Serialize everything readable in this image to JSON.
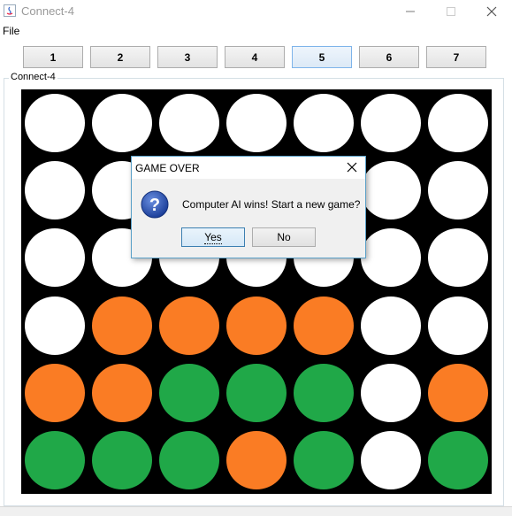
{
  "window": {
    "title": "Connect-4"
  },
  "menu": {
    "file": "File"
  },
  "column_buttons": [
    "1",
    "2",
    "3",
    "4",
    "5",
    "6",
    "7"
  ],
  "active_column_index": 4,
  "group": {
    "label": "Connect-4"
  },
  "board": {
    "rows": 6,
    "cols": 7,
    "cells": [
      [
        "empty",
        "empty",
        "empty",
        "empty",
        "empty",
        "empty",
        "empty"
      ],
      [
        "empty",
        "empty",
        "empty",
        "empty",
        "empty",
        "empty",
        "empty"
      ],
      [
        "empty",
        "empty",
        "empty",
        "empty",
        "empty",
        "empty",
        "empty"
      ],
      [
        "empty",
        "orange",
        "orange",
        "orange",
        "orange",
        "empty",
        "empty"
      ],
      [
        "orange",
        "orange",
        "green",
        "green",
        "green",
        "empty",
        "orange"
      ],
      [
        "green",
        "green",
        "green",
        "orange",
        "green",
        "empty",
        "green"
      ]
    ],
    "colors": {
      "empty": "#ffffff",
      "orange": "#fa7c24",
      "green": "#20a848",
      "background": "#000000"
    }
  },
  "dialog": {
    "title": "GAME OVER",
    "icon": "question-icon",
    "message": "Computer AI wins! Start a new game?",
    "yes_label": "Yes",
    "no_label": "No"
  }
}
